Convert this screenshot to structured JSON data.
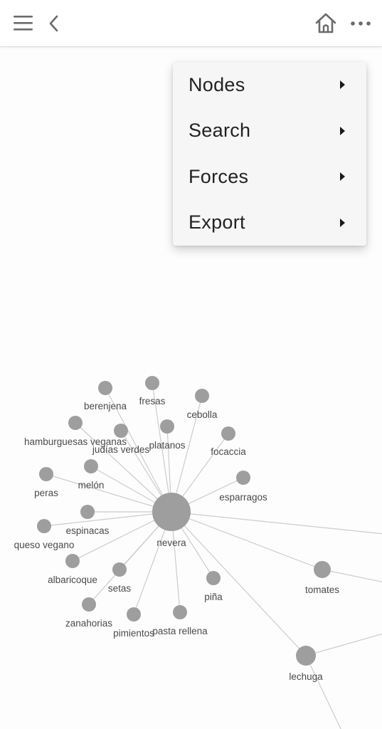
{
  "toolbar": {
    "menu_icon": "hamburger-menu-icon",
    "back_icon": "chevron-left-icon",
    "home_icon": "home-icon",
    "more_icon": "more-horizontal-icon"
  },
  "menu": {
    "items": [
      {
        "label": "Nodes",
        "icon": "caret-right-icon"
      },
      {
        "label": "Search",
        "icon": "caret-right-icon"
      },
      {
        "label": "Forces",
        "icon": "caret-right-icon"
      },
      {
        "label": "Export",
        "icon": "caret-right-icon"
      }
    ]
  },
  "graph": {
    "colors": {
      "node": "#9e9e9e",
      "edge": "#cccccc",
      "label": "#4a4a4a"
    },
    "nodes": [
      {
        "id": "nevera",
        "label": "nevera"
      },
      {
        "id": "berenjena",
        "label": "berenjena"
      },
      {
        "id": "fresas",
        "label": "fresas"
      },
      {
        "id": "cebolla",
        "label": "cebolla"
      },
      {
        "id": "hamburguesas_veganas",
        "label": "hamburguesas veganas"
      },
      {
        "id": "judias_verdes",
        "label": "judías verdes"
      },
      {
        "id": "platanos",
        "label": "platanos"
      },
      {
        "id": "focaccia",
        "label": "focaccia"
      },
      {
        "id": "peras",
        "label": "peras"
      },
      {
        "id": "melon",
        "label": "melón"
      },
      {
        "id": "esparragos",
        "label": "esparragos"
      },
      {
        "id": "espinacas",
        "label": "espinacas"
      },
      {
        "id": "queso_vegano",
        "label": "queso vegano"
      },
      {
        "id": "albaricoque",
        "label": "albaricoque"
      },
      {
        "id": "setas",
        "label": "setas"
      },
      {
        "id": "zanahorias",
        "label": "zanahorias"
      },
      {
        "id": "pimientos",
        "label": "pimientos"
      },
      {
        "id": "pasta_rellena",
        "label": "pasta rellena"
      },
      {
        "id": "pina",
        "label": "piña"
      },
      {
        "id": "tomates",
        "label": "tomates"
      },
      {
        "id": "lechuga",
        "label": "lechuga"
      }
    ],
    "edges": [
      [
        "nevera",
        "berenjena"
      ],
      [
        "nevera",
        "fresas"
      ],
      [
        "nevera",
        "cebolla"
      ],
      [
        "nevera",
        "hamburguesas_veganas"
      ],
      [
        "nevera",
        "judias_verdes"
      ],
      [
        "nevera",
        "platanos"
      ],
      [
        "nevera",
        "focaccia"
      ],
      [
        "nevera",
        "peras"
      ],
      [
        "nevera",
        "melon"
      ],
      [
        "nevera",
        "esparragos"
      ],
      [
        "nevera",
        "espinacas"
      ],
      [
        "nevera",
        "queso_vegano"
      ],
      [
        "nevera",
        "albaricoque"
      ],
      [
        "nevera",
        "setas"
      ],
      [
        "nevera",
        "zanahorias"
      ],
      [
        "nevera",
        "pimientos"
      ],
      [
        "nevera",
        "pasta_rellena"
      ],
      [
        "nevera",
        "pina"
      ],
      [
        "nevera",
        "tomates"
      ],
      [
        "nevera",
        "lechuga"
      ]
    ]
  }
}
